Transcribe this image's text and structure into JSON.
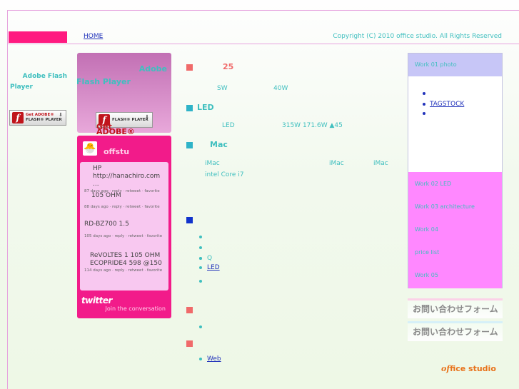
{
  "header": {
    "home_link": "HOME",
    "copyright": "Copyright (C) 2010 office studio. All Rights Reserved"
  },
  "flash": {
    "left_title_line1": "Adobe Flash",
    "left_title_line2": "Player",
    "badge_adobe": "Get ADOBE®",
    "badge_player": "FLASH® PLAYER",
    "pink_adobe": "Adobe",
    "pink_flash_player": "Flash Player"
  },
  "twitter": {
    "name": "offstu",
    "tweets": [
      {
        "text": "HP http://hanachiro.com ...",
        "meta": "87 days ago · reply · retweet · favorite"
      },
      {
        "text": "105 OHM",
        "meta": "88 days ago · reply · retweet · favorite"
      },
      {
        "text": "RD-BZ700 1.5",
        "meta": "105 days ago · reply · retweet · favorite"
      },
      {
        "text": "ReVOLTES 1 105 OHM ECOPRIDE4 598 @150",
        "meta": "114 days ago · reply · retweet · favorite"
      }
    ],
    "logo": "twitter",
    "join": "Join the conversation"
  },
  "main": {
    "sec1_head": "25",
    "sec1_sw": "SW",
    "sec1_40w": "40W",
    "sec2_head": "LED",
    "sec2_led": "LED",
    "sec2_vals": "315W 171.6W ▲45",
    "sec3_head": "Mac",
    "sec3_imac1": "iMac",
    "sec3_imac2": "iMac",
    "sec3_imac3": "iMac",
    "sec3_cpu": "intel Core i7",
    "list1": [
      "",
      "",
      "",
      "Q",
      "LED",
      ""
    ],
    "list2": [
      ""
    ],
    "list3": [
      "Web"
    ]
  },
  "right": {
    "items": [
      "Work 01 photo",
      "Work 02 LED",
      "Work 03 architecture",
      "Work 04",
      "price list",
      "Work 05"
    ],
    "sublist": [
      "",
      "TAGSTOCK",
      ""
    ],
    "contact1": "お問い合わせフォーム",
    "contact2": "お問い合わせフォーム",
    "logo_of": "of",
    "logo_text": "fice studio"
  },
  "colors": {
    "accent_pink": "#ff1a80",
    "teal_text": "#3fbfbf",
    "link_blue": "#2233bb",
    "section_red": "#f06a6a",
    "section_teal": "#2fb3c8",
    "section_blue": "#1133cc"
  }
}
